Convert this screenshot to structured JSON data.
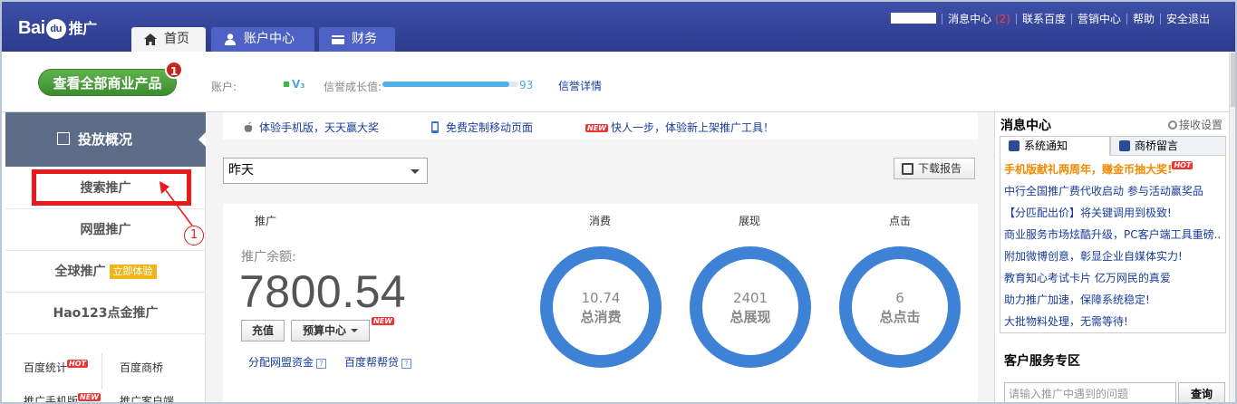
{
  "header": {
    "logo_text": "Bai",
    "logo_paw": "du",
    "logo_suffix": "推广",
    "tabs": [
      {
        "label": "首页",
        "icon": "home-icon"
      },
      {
        "label": "账户中心",
        "icon": "user-icon"
      },
      {
        "label": "财务",
        "icon": "card-icon"
      }
    ],
    "links": {
      "messages": "消息中心",
      "message_count": "(2)",
      "contact": "联系百度",
      "marketing": "营销中心",
      "help": "帮助",
      "logout": "安全退出"
    }
  },
  "subheader": {
    "all_products_button": "查看全部商业产品",
    "all_products_badge": "1",
    "account_label": "账户:",
    "level": "V₃",
    "credit_label": "信誉成长值:",
    "credit_value": 93,
    "credit_link": "信誉详情"
  },
  "sidebar": {
    "head": "投放概况",
    "items": [
      {
        "label": "搜索推广"
      },
      {
        "label": "网盟推广"
      },
      {
        "label": "全球推广",
        "badge": "立即体验"
      },
      {
        "label": "Hao123点金推广"
      }
    ],
    "small": [
      {
        "label": "百度统计",
        "badge": "HOT"
      },
      {
        "label": "百度商桥"
      },
      {
        "label": "推广手机版",
        "badge": "NEW"
      },
      {
        "label": "推广客户端"
      }
    ]
  },
  "main": {
    "notices": [
      {
        "text": "体验手机版，天天赢大奖",
        "icon": "apple-icon"
      },
      {
        "text": "免费定制移动页面",
        "icon": "phone-icon"
      },
      {
        "text": "快人一步，体验新上架推广工具！",
        "badge": "NEW"
      }
    ],
    "date_select": "昨天",
    "download_button": "下载报告",
    "columns": {
      "promo": "推广",
      "cost": "消费",
      "impressions": "展现",
      "clicks": "点击"
    },
    "balance_label": "推广余额:",
    "balance": "7800.54",
    "recharge_button": "充值",
    "budget_button": "预算中心",
    "budget_badge": "NEW",
    "links": {
      "alloc": "分配网盟资金",
      "loan": "百度帮帮贷"
    },
    "donuts": [
      {
        "value": "10.74",
        "label": "总消费"
      },
      {
        "value": "2401",
        "label": "总展现"
      },
      {
        "value": "6",
        "label": "总点击"
      }
    ]
  },
  "right": {
    "title": "消息中心",
    "settings": "接收设置",
    "tabs": [
      {
        "label": "系统通知"
      },
      {
        "label": "商桥留言"
      }
    ],
    "items": [
      {
        "text": "手机版献礼两周年，赚金币抽大奖!",
        "badge": "HOT",
        "highlight": true
      },
      {
        "text": "中行全国推广费代收启动 参与活动赢奖品"
      },
      {
        "text": "【分匹配出价】将关键调用到极致!"
      },
      {
        "text": "商业服务市场炫酷升级，PC客户端工具重磅..."
      },
      {
        "text": "附加微博创意，彰显企业自媒体实力!"
      },
      {
        "text": "教育知心考试卡片 亿万网民的真爱"
      },
      {
        "text": "助力推广加速，保障系统稳定!"
      },
      {
        "text": "大批物料处理，无需等待!"
      }
    ],
    "service_title": "客户服务专区",
    "search_placeholder": "请输入推广中遇到的问题",
    "search_button": "查询"
  },
  "annotation": {
    "number": "1"
  },
  "colors": {
    "brand_blue": "#2c3b8d",
    "donut_blue": "#3e82d6",
    "alert_red": "#e8181b",
    "green_button": "#4b9e3c"
  }
}
